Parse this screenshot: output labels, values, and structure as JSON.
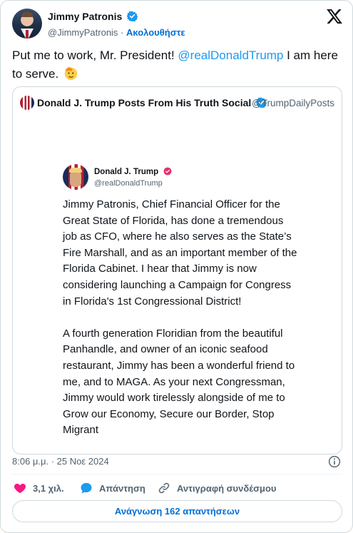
{
  "author": {
    "name": "Jimmy Patronis",
    "handle": "@JimmyPatronis",
    "separator": " · ",
    "follow_label": "Ακολουθήστε"
  },
  "tweet": {
    "text_before": "Put me to work, Mr. President! ",
    "mention": "@realDonaldTrump",
    "text_after": " I am here to serve.",
    "emoji": "saluting-face-icon"
  },
  "quote": {
    "name": "Donald J. Trump Posts From His Truth Social",
    "handle": "@TrumpDailyPosts",
    "inner": {
      "name": "Donald J. Trump",
      "handle": "@realDonaldTrump",
      "paragraphs": [
        "Jimmy Patronis, Chief Financial Officer for the Great State of Florida, has done a tremendous job as CFO, where he also serves as the State’s Fire Marshall, and as an important member of the Florida Cabinet. I hear that Jimmy is now considering launching a Campaign for Congress in Florida's 1st Congressional District!",
        "A fourth generation Floridian from the beautiful Panhandle, and owner of an iconic seafood restaurant, Jimmy has been a wonderful friend to me, and to MAGA. As your next Congressman, Jimmy would work tirelessly alongside of me to Grow our Economy, Secure our Border, Stop Migrant"
      ]
    }
  },
  "footer": {
    "timestamp": "8:06 μ.μ. · 25 Νοε 2024",
    "likes": "3,1 χιλ.",
    "reply_label": "Απάντηση",
    "copy_label": "Αντιγραφή συνδέσμου",
    "read_replies_label": "Ανάγνωση 162 απαντήσεων"
  },
  "colors": {
    "accent": "#1d9bf0",
    "link": "#006fd6",
    "like": "#f91880",
    "secondary_text": "#536471",
    "border": "#cfd9de"
  }
}
